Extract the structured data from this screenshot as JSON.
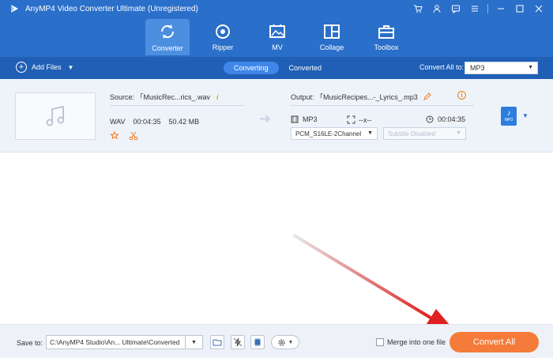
{
  "window": {
    "title": "AnyMP4 Video Converter Ultimate (Unregistered)"
  },
  "nav": {
    "tabs": [
      {
        "label": "Converter",
        "icon": "converter-icon",
        "active": true
      },
      {
        "label": "Ripper",
        "icon": "disc-icon",
        "active": false
      },
      {
        "label": "MV",
        "icon": "mv-image-icon",
        "active": false
      },
      {
        "label": "Collage",
        "icon": "collage-grid-icon",
        "active": false
      },
      {
        "label": "Toolbox",
        "icon": "toolbox-icon",
        "active": false
      }
    ]
  },
  "toolbar": {
    "add_files_label": "Add Files",
    "sub_tabs": [
      "Converting",
      "Converted"
    ],
    "convert_all_to_label": "Convert All to:",
    "convert_all_to_value": "MP3"
  },
  "file_item": {
    "source_label": "Source: 「MusicRec...rics_.wav",
    "format": "WAV",
    "duration": "00:04:35",
    "size": "50.42 MB",
    "output_label": "Output: 「MusicRecipes...-_Lyrics_.mp3",
    "output_format": "MP3",
    "output_resolution": "--x--",
    "output_duration": "00:04:35",
    "audio_codec": "PCM_S16LE-2Channel",
    "subtitle": "Subtitle Disabled",
    "badge_text": "MP3"
  },
  "bottom": {
    "save_to_label": "Save to:",
    "save_path": "C:\\AnyMP4 Studio\\An... Ultimate\\Converted",
    "merge_label": "Merge into one file",
    "merge_checked": false,
    "convert_all_label": "Convert All"
  },
  "colors": {
    "header_blue": "#2a6fc9",
    "toolbar_blue": "#1f5fb5",
    "accent_orange": "#f57b3a",
    "arrow_red": "#e02020"
  }
}
